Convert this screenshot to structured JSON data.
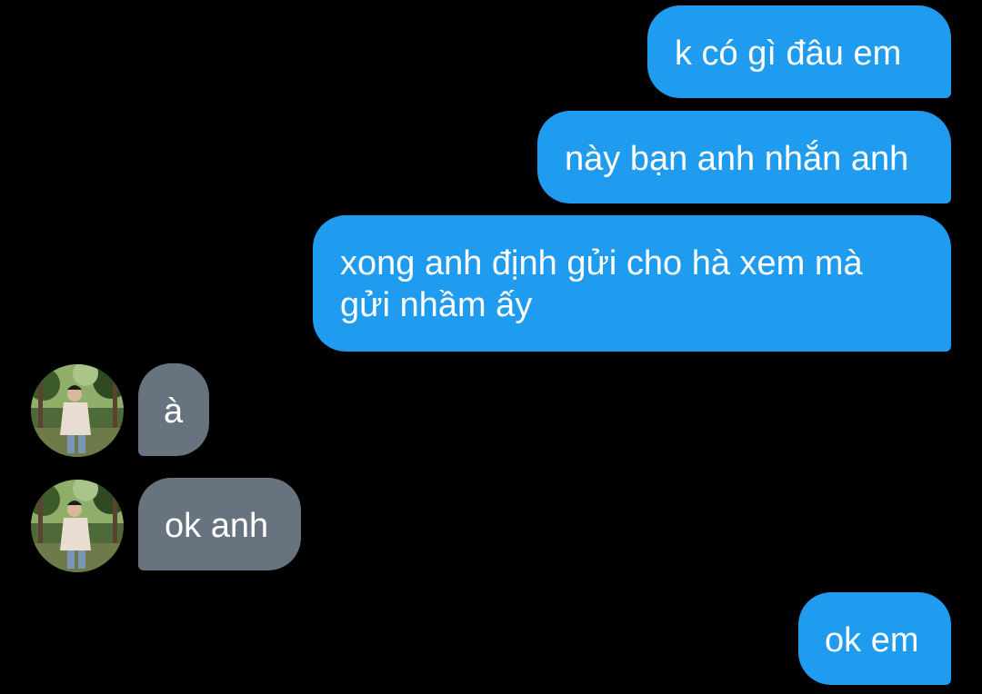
{
  "messages": [
    {
      "direction": "outgoing",
      "text": "k có gì đâu em"
    },
    {
      "direction": "outgoing",
      "text": "này bạn anh nhắn anh"
    },
    {
      "direction": "outgoing",
      "text": "xong anh định gửi cho hà xem mà\ngửi nhầm ấy"
    },
    {
      "direction": "incoming",
      "text": "à"
    },
    {
      "direction": "incoming",
      "text": "ok anh"
    },
    {
      "direction": "outgoing",
      "text": "ok em"
    }
  ],
  "colors": {
    "background": "#000000",
    "outgoing_bubble": "#1f9bef",
    "incoming_bubble": "#67747f",
    "text": "#ffffff"
  }
}
